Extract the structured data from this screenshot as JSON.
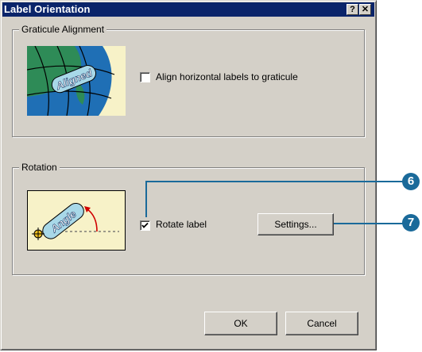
{
  "window": {
    "title": "Label Orientation",
    "help_glyph": "?",
    "close_glyph": "✕"
  },
  "graticule": {
    "group_label": "Graticule Alignment",
    "image_text": "Aligned",
    "checkbox_label": "Align horizontal labels to graticule",
    "checked": false
  },
  "rotation": {
    "group_label": "Rotation",
    "image_text": "Angle",
    "checkbox_label": "Rotate label",
    "checked": true,
    "settings_label": "Settings..."
  },
  "buttons": {
    "ok": "OK",
    "cancel": "Cancel"
  },
  "callouts": {
    "step6": "6",
    "step7": "7",
    "color": "#1a6a9a"
  }
}
